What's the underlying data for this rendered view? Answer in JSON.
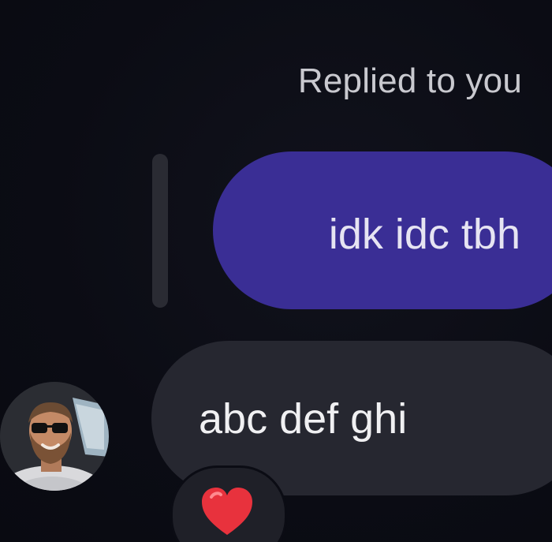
{
  "thread": {
    "reply_header": "Replied to you",
    "quoted_message": "idk idc tbh",
    "message": "abc def ghi",
    "reaction": "heart-emoji"
  },
  "colors": {
    "background": "#0b0c14",
    "quoted_bubble": "#3a2e95",
    "message_bubble": "#262730",
    "reply_bar": "#2a2b33",
    "heart": "#e8323d"
  }
}
